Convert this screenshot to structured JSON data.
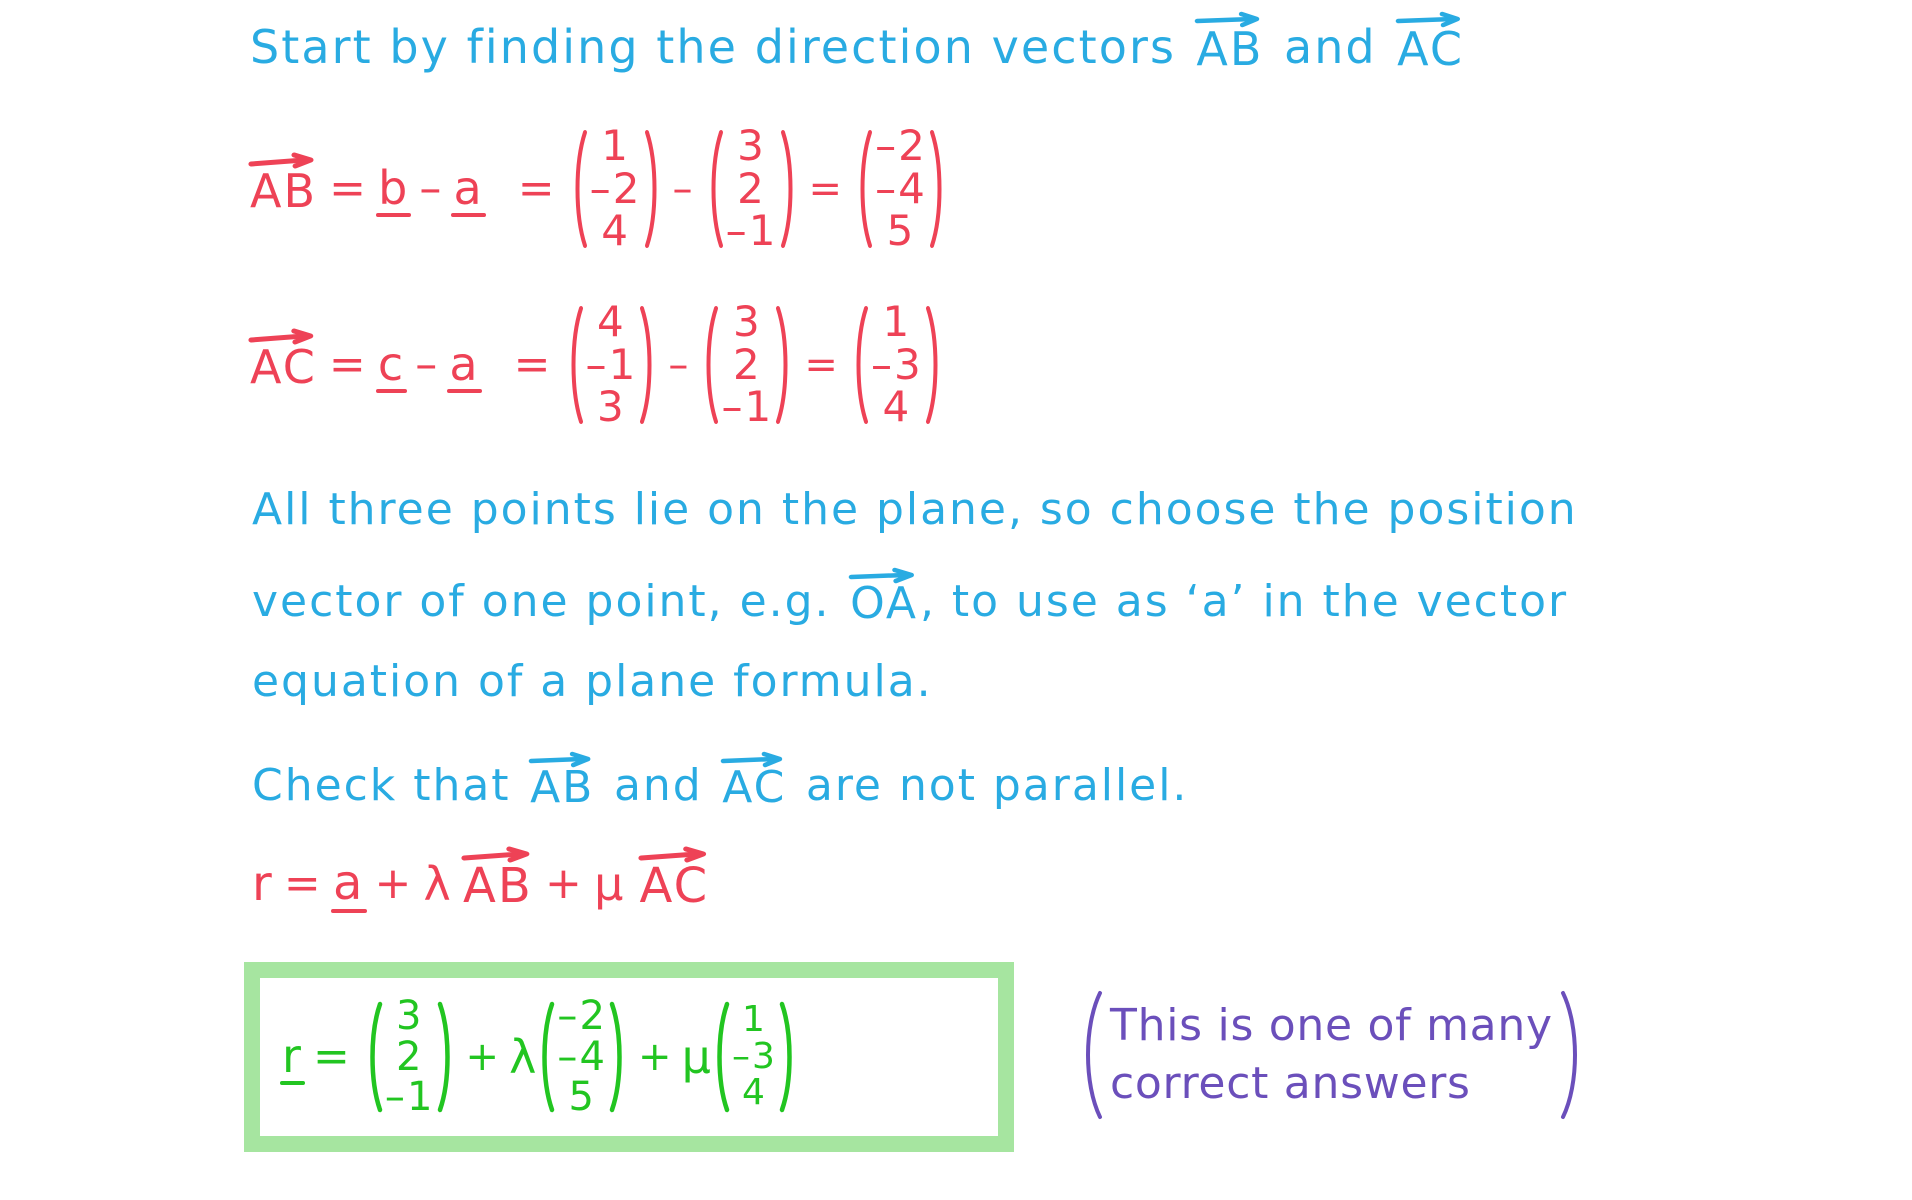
{
  "colors": {
    "blue": "#29ABE2",
    "red": "#EE4256",
    "green": "#22C521",
    "purple": "#6B4FBB",
    "highlight_box": "#A6E5A0",
    "background": "#FFFFFF"
  },
  "heading": {
    "part1": "Start by finding the direction vectors",
    "vec1": "AB",
    "and": "and",
    "vec2": "AC"
  },
  "working": {
    "ab": {
      "name": "AB",
      "eq1": "=",
      "term1": "b",
      "minus": "–",
      "term2": "a",
      "eq2": "=",
      "vec_b": [
        "1",
        "–2",
        "4"
      ],
      "minus2": "–",
      "vec_a": [
        "3",
        "2",
        "–1"
      ],
      "eq3": "=",
      "result": [
        "–2",
        "–4",
        "5"
      ]
    },
    "ac": {
      "name": "AC",
      "eq1": "=",
      "term1": "c",
      "minus": "–",
      "term2": "a",
      "eq2": "=",
      "vec_c": [
        "4",
        "–1",
        "3"
      ],
      "minus2": "–",
      "vec_a": [
        "3",
        "2",
        "–1"
      ],
      "eq3": "=",
      "result": [
        "1",
        "–3",
        "4"
      ]
    }
  },
  "notes": {
    "line1": "All three points lie on the plane, so choose the position",
    "line2_a": "vector of one point,   e.g.",
    "line2_vec": "OA",
    "line2_b": ",   to use   as   ‘a’   in the   vector",
    "line3": "equation  of  a  plane   formula.",
    "check_a": "Check   that",
    "check_vec1": "AB",
    "check_mid": "and",
    "check_vec2": "AC",
    "check_b": "are   not  parallel."
  },
  "formula": {
    "r": "r",
    "eq": "=",
    "a": "a",
    "plus1": "+",
    "lambda": "λ",
    "vec1": "AB",
    "plus2": "+",
    "mu": "μ",
    "vec2": "AC"
  },
  "answer": {
    "r": "r",
    "eq": "=",
    "position_vector": [
      "3",
      "2",
      "–1"
    ],
    "plus1": "+",
    "lambda": "λ",
    "direction1": [
      "–2",
      "–4",
      "5"
    ],
    "plus2": "+",
    "mu": "μ",
    "direction2": [
      "1",
      "–3",
      "4"
    ]
  },
  "comment": {
    "line1": "This  is  one  of  many",
    "line2": "correct  answers"
  }
}
